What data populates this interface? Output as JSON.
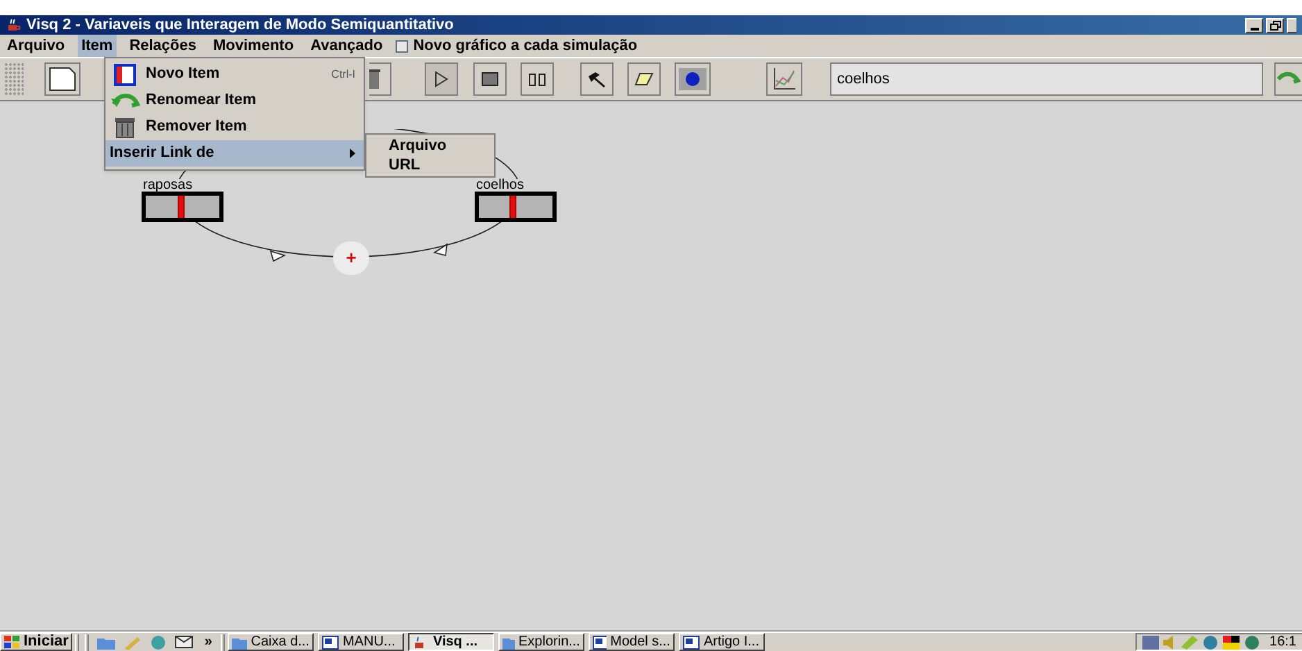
{
  "window": {
    "title": "Visq 2 - Variaveis que Interagem de Modo Semiquantitativo"
  },
  "menu_bar": {
    "items": [
      {
        "label": "Arquivo",
        "selected": false
      },
      {
        "label": "Item",
        "selected": true
      },
      {
        "label": "Relações",
        "selected": false
      },
      {
        "label": "Movimento",
        "selected": false
      },
      {
        "label": "Avançado",
        "selected": false
      }
    ],
    "checkbox": {
      "label": "Novo gráfico a cada simulação",
      "checked": false
    }
  },
  "item_menu": {
    "items": [
      {
        "kind": "new",
        "label": "Novo Item",
        "shortcut": "Ctrl-I",
        "selected": false
      },
      {
        "kind": "rename",
        "label": "Renomear Item",
        "selected": false
      },
      {
        "kind": "remove",
        "label": "Remover Item",
        "selected": false
      },
      {
        "kind": "submenu",
        "label": "Inserir Link de",
        "selected": true
      }
    ]
  },
  "submenu": {
    "items": [
      {
        "label": "Arquivo"
      },
      {
        "label": "URL"
      }
    ]
  },
  "toolbar": {
    "field_value": "coelhos"
  },
  "diagram": {
    "nodes": [
      {
        "label": "raposas",
        "level": 0.48
      },
      {
        "label": "coelhos",
        "level": 0.45
      }
    ],
    "relation": {
      "symbol": "+"
    }
  },
  "taskbar": {
    "start": "Iniciar",
    "more": "»",
    "tasks": [
      {
        "label": "Caixa d...",
        "kind": "folder",
        "selected": false
      },
      {
        "label": "MANU...",
        "kind": "doc",
        "selected": false
      },
      {
        "label": "Visq ...",
        "kind": "java",
        "selected": true
      },
      {
        "label": "Explorin...",
        "kind": "folder",
        "selected": false
      },
      {
        "label": "Model s...",
        "kind": "doc",
        "selected": false
      },
      {
        "label": "Artigo I...",
        "kind": "doc",
        "selected": false
      }
    ],
    "clock": "16:1"
  }
}
